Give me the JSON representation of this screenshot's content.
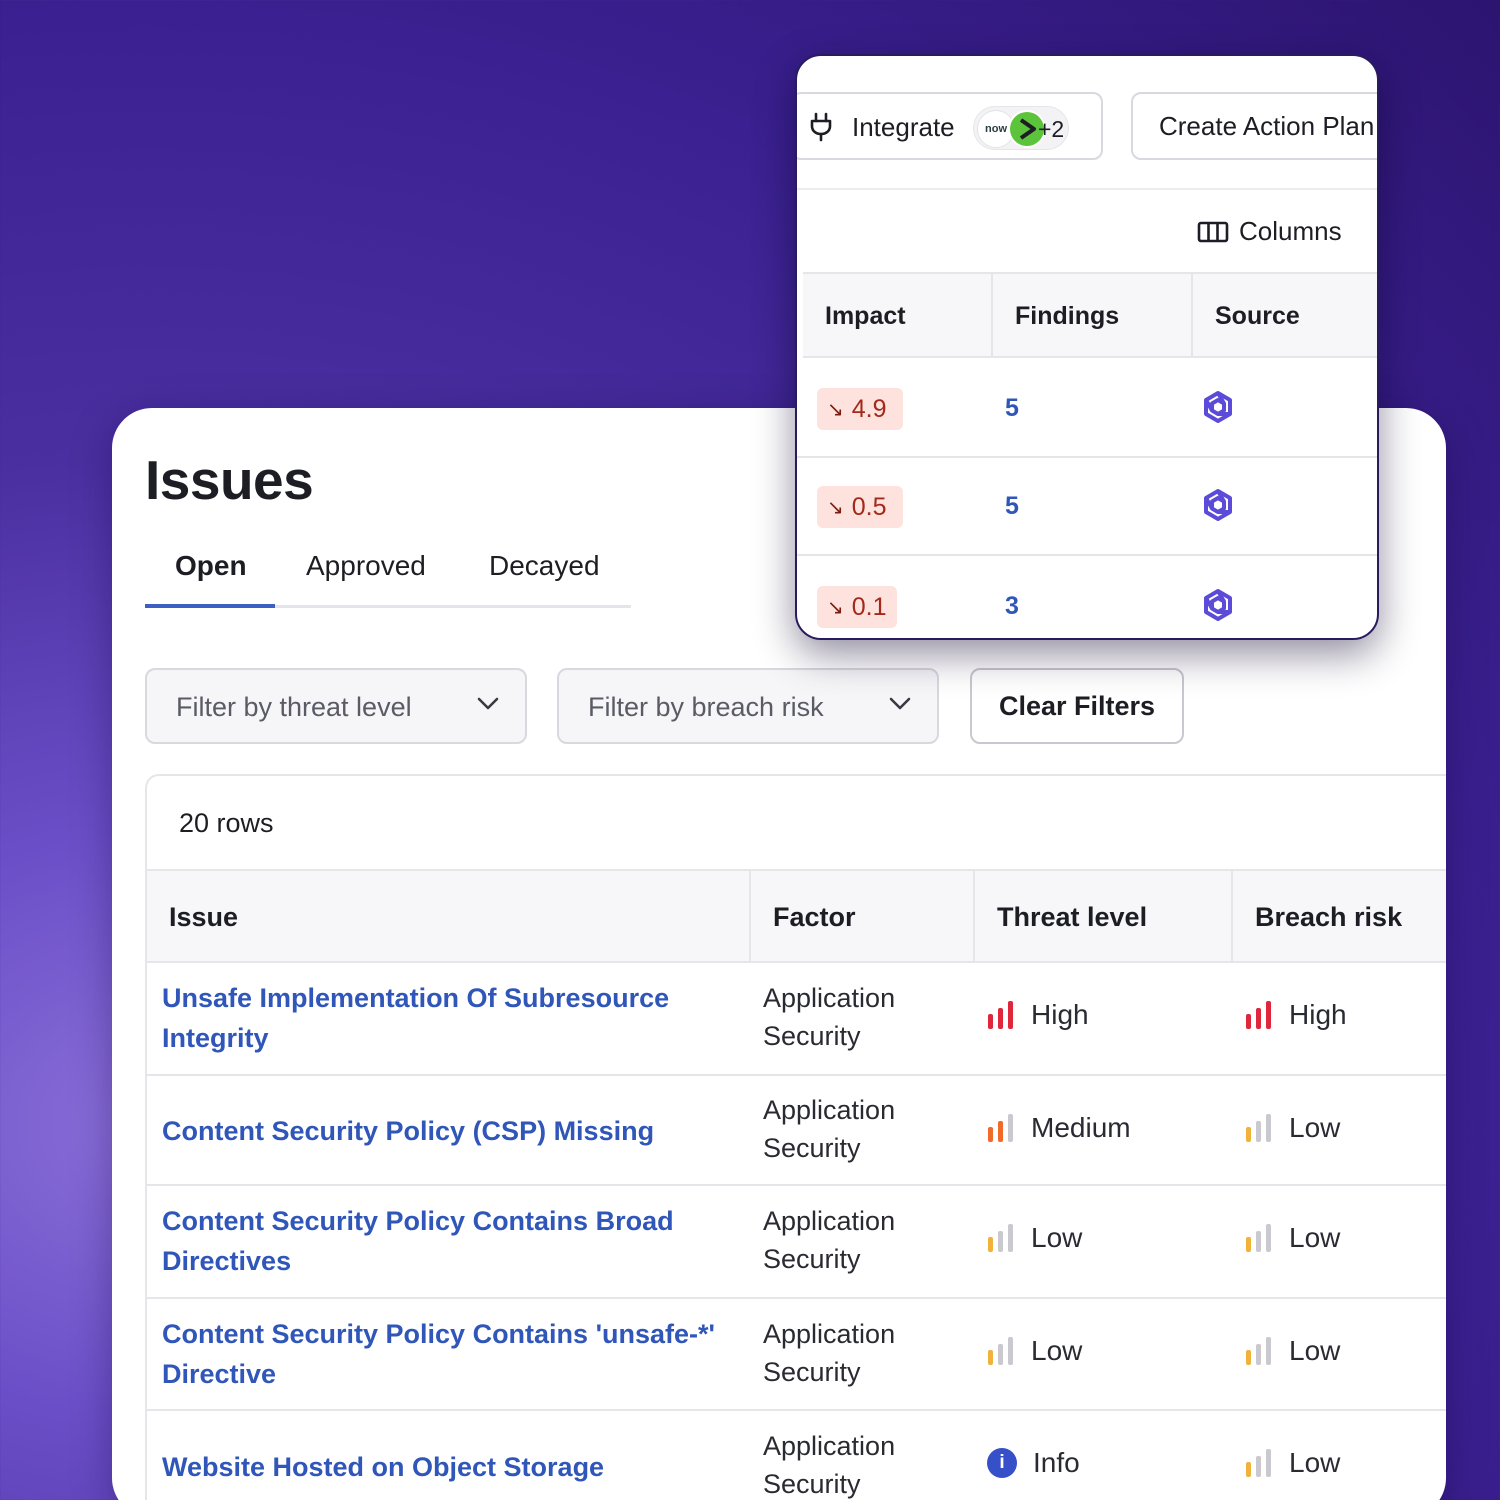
{
  "issues": {
    "title": "Issues",
    "tabs": [
      {
        "label": "Open",
        "active": true
      },
      {
        "label": "Approved",
        "active": false
      },
      {
        "label": "Decayed",
        "active": false
      }
    ],
    "filters": {
      "threat_placeholder": "Filter by threat level",
      "breach_placeholder": "Filter by breach risk",
      "clear_label": "Clear Filters"
    },
    "row_count": "20 rows",
    "columns": [
      "Issue",
      "Factor",
      "Threat level",
      "Breach risk"
    ],
    "rows": [
      {
        "issue": "Unsafe Implementation Of Subresource Integrity",
        "factor": "Application Security",
        "threat": "High",
        "breach": "High"
      },
      {
        "issue": "Content Security Policy (CSP) Missing",
        "factor": "Application Security",
        "threat": "Medium",
        "breach": "Low"
      },
      {
        "issue": "Content Security Policy Contains Broad Directives",
        "factor": "Application Security",
        "threat": "Low",
        "breach": "Low"
      },
      {
        "issue": "Content Security Policy Contains 'unsafe-*' Directive",
        "factor": "Application Security",
        "threat": "Low",
        "breach": "Low"
      },
      {
        "issue": "Website Hosted on Object Storage",
        "factor": "Application Security",
        "threat": "Info",
        "breach": "Low"
      }
    ]
  },
  "popup": {
    "integrate_label": "Integrate",
    "integration_chip": "now",
    "integration_more": "+2",
    "action_plan_label": "Create Action Plan",
    "columns_label": "Columns",
    "columns": [
      "Impact",
      "Findings",
      "Source"
    ],
    "rows": [
      {
        "impact": "4.9",
        "findings": "5",
        "source_icon": "source-logo-icon"
      },
      {
        "impact": "0.5",
        "findings": "5",
        "source_icon": "source-logo-icon"
      },
      {
        "impact": "0.1",
        "findings": "3",
        "source_icon": "source-logo-icon"
      }
    ]
  },
  "colors": {
    "link": "#2f56b8",
    "high": "#e0263a",
    "medium": "#f06a2a",
    "low": "#f0b23a",
    "info": "#3550c8",
    "impact_bg": "#fde2dd",
    "source_icon": "#5b4bd8"
  }
}
